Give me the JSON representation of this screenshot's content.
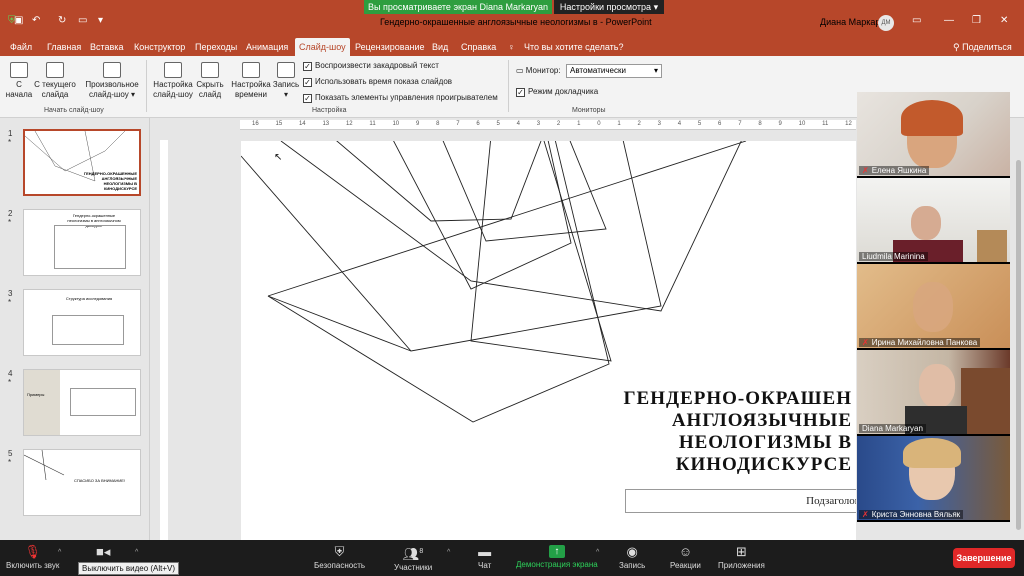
{
  "window": {
    "doc_title": "Гендерно-окрашенные англоязычные неологизмы в  -  PowerPoint",
    "user_name": "Диана Маркарян",
    "user_initials": "ДМ"
  },
  "share": {
    "banner": "Вы просматриваете экран Diana Markaryan",
    "settings": "Настройки просмотра"
  },
  "tabs": [
    "Файл",
    "Главная",
    "Вставка",
    "Конструктор",
    "Переходы",
    "Анимация",
    "Слайд-шоу",
    "Рецензирование",
    "Вид",
    "Справка"
  ],
  "tell_me": "Что вы хотите сделать?",
  "share_label": "Поделиться",
  "ribbon": {
    "from_start": [
      "С",
      "начала"
    ],
    "from_current": [
      "С текущего",
      "слайда"
    ],
    "custom_show": [
      "Произвольное",
      "слайд-шоу"
    ],
    "group_start": "Начать слайд-шоу",
    "setup_show": [
      "Настройка",
      "слайд-шоу"
    ],
    "hide_slide": [
      "Скрыть",
      "слайд"
    ],
    "rehearse": [
      "Настройка",
      "времени"
    ],
    "record": "Запись",
    "group_setup": "Настройка",
    "chk_narration": "Воспроизвести закадровый текст",
    "chk_timings": "Использовать время показа слайдов",
    "chk_controls": "Показать элементы управления проигрывателем",
    "monitor_label": "Монитор:",
    "monitor_value": "Автоматически",
    "chk_presenter": "Режим докладчика",
    "group_monitors": "Мониторы"
  },
  "thumbnails": [
    {
      "num": "1",
      "text": "ГЕНДЕРНО-ОКРАШЕННЫЕ АНГЛОЯЗЫЧНЫЕ НЕОЛОГИЗМЫ В КИНОДИСКУРСЕ"
    },
    {
      "num": "2",
      "text": "Гендерно-окрашенные неологизмы в англоязычном дискурсе"
    },
    {
      "num": "3",
      "text": "Структура исследования"
    },
    {
      "num": "4",
      "text": "Примеры"
    },
    {
      "num": "5",
      "text": "СПАСИБО ЗА ВНИМАНИЕ!"
    }
  ],
  "ruler_ticks": [
    "16",
    "15",
    "14",
    "13",
    "12",
    "11",
    "10",
    "9",
    "8",
    "7",
    "6",
    "5",
    "4",
    "3",
    "2",
    "1",
    "0",
    "1",
    "2",
    "3",
    "4",
    "5",
    "6",
    "7",
    "8",
    "9",
    "10",
    "11",
    "12"
  ],
  "slide": {
    "title_lines": [
      "ГЕНДЕРНО-ОКРАШЕН",
      "АНГЛОЯЗЫЧНЫЕ",
      "НЕОЛОГИЗМЫ В",
      "КИНОДИСКУРСЕ"
    ],
    "subtitle": "Подзаголов"
  },
  "participants": [
    {
      "name": "Елена Яшкина",
      "muted": true
    },
    {
      "name": "Liudmila Marinina",
      "muted": false
    },
    {
      "name": "Ирина Михайловна Панкова",
      "muted": true
    },
    {
      "name": "Diana Markaryan",
      "muted": false
    },
    {
      "name": "Криста Энновна Вяльяк",
      "muted": true
    }
  ],
  "zoom": {
    "unmute": "Включить звук",
    "video_tooltip": "Выключить видео (Alt+V)",
    "security": "Безопасность",
    "participants": "Участники",
    "participants_count": "8",
    "chat": "Чат",
    "share_screen": "Демонстрация экрана",
    "record": "Запись",
    "reactions": "Реакции",
    "apps": "Приложения",
    "end": "Завершение"
  }
}
